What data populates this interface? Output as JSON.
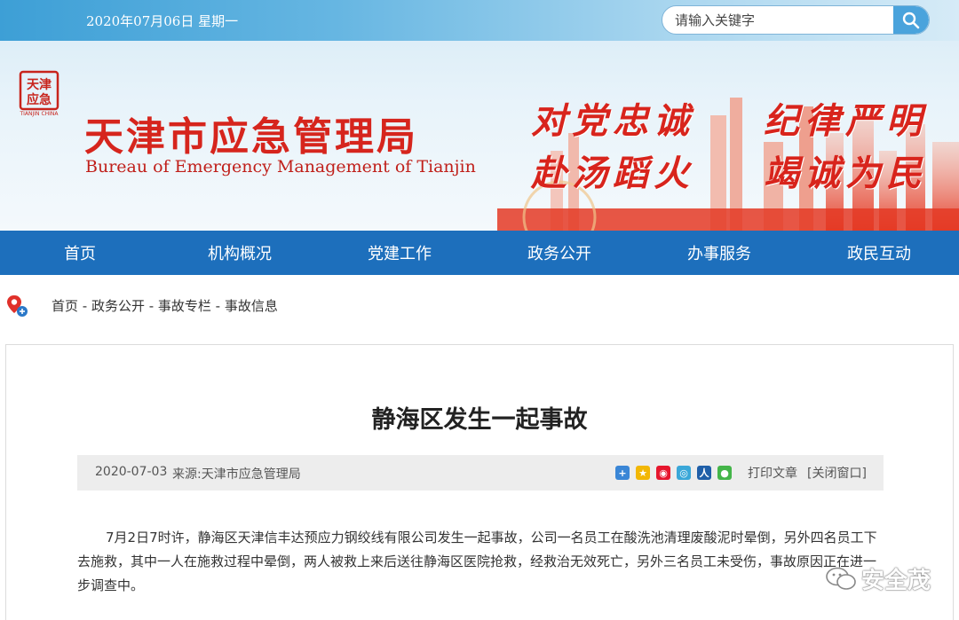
{
  "header": {
    "date": "2020年07月06日 星期一",
    "search_placeholder": "请输入关键字",
    "logo_text": "天津应急",
    "title": "天津市应急管理局",
    "subtitle": "Bureau of Emergency Management of Tianjin",
    "slogans": [
      "对党忠诚",
      "纪律严明",
      "赴汤蹈火",
      "竭诚为民"
    ]
  },
  "nav": {
    "items": [
      "首页",
      "机构概况",
      "党建工作",
      "政务公开",
      "办事服务",
      "政民互动"
    ]
  },
  "breadcrumb": {
    "text": "首页 - 政务公开 - 事故专栏 - 事故信息"
  },
  "article": {
    "title": "静海区发生一起事故",
    "date": "2020-07-03",
    "source": "来源:天津市应急管理局",
    "print_label": "打印文章",
    "close_label": "[关闭窗口]",
    "body": "7月2日7时许，静海区天津信丰达预应力钢绞线有限公司发生一起事故，公司一名员工在酸洗池清理废酸泥时晕倒，另外四名员工下去施救，其中一人在施救过程中晕倒，两人被救上来后送往静海区医院抢救，经救治无效死亡，另外三名员工未受伤，事故原因正在进一步调查中。"
  },
  "share_icons": [
    "more-share-icon",
    "qzone-icon",
    "weibo-icon",
    "tencent-weibo-icon",
    "renren-icon",
    "wechat-icon"
  ],
  "watermark": {
    "text": "安全茂"
  },
  "colors": {
    "brand_red": "#d6251d",
    "nav_blue": "#1d6fbc",
    "meta_bg": "#ededed"
  }
}
